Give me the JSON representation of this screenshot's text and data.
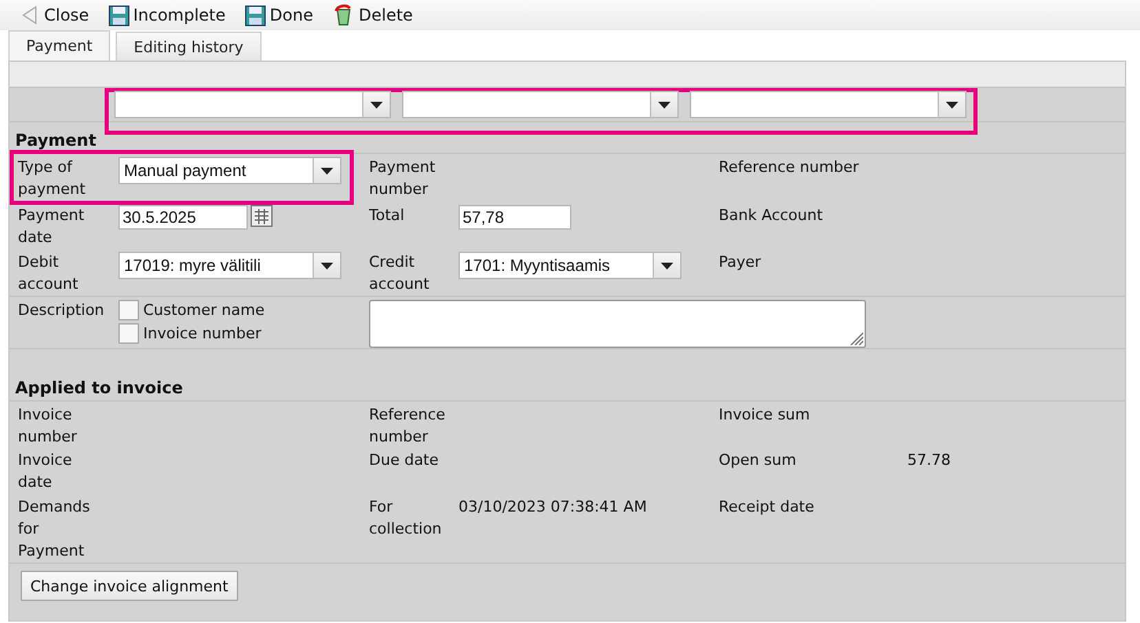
{
  "toolbar": [
    {
      "label": "Close",
      "kind": "back"
    },
    {
      "label": "Incomplete",
      "kind": "save"
    },
    {
      "label": "Done",
      "kind": "save"
    },
    {
      "label": "Delete",
      "kind": "delete"
    }
  ],
  "tabs": [
    {
      "label": "Payment",
      "selected": true
    },
    {
      "label": "Editing history",
      "selected": false
    }
  ],
  "filter_row": {
    "highlighted": true,
    "dropdowns": [
      {
        "kind": "select"
      },
      {
        "kind": "select"
      },
      {
        "kind": "select"
      }
    ]
  },
  "payment": {
    "title": "Payment",
    "type_of_payment": {
      "label": "Type of payment",
      "value": "Manual payment",
      "highlighted": true
    },
    "payment_number": {
      "label": "Payment number"
    },
    "reference_number": {
      "label": "Reference number"
    },
    "payment_date": {
      "label": "Payment date",
      "value": "30.5.2025"
    },
    "total": {
      "label": "Total",
      "value": "57,78"
    },
    "bank_account": {
      "label": "Bank Account"
    },
    "debit_account": {
      "label": "Debit account",
      "value": "17019: myre välitili"
    },
    "credit_account": {
      "label": "Credit account",
      "value": "1701: Myyntisaamis"
    },
    "payer": {
      "label": "Payer"
    },
    "description": {
      "label": "Description",
      "options": [
        {
          "label": "Customer name",
          "checked": false
        },
        {
          "label": "Invoice number",
          "checked": false
        }
      ]
    }
  },
  "applied": {
    "title": "Applied to invoice",
    "rows": [
      [
        {
          "label": "Invoice number"
        },
        {
          "label": "Reference number"
        },
        {
          "label": "Invoice sum"
        }
      ],
      [
        {
          "label": "Invoice date"
        },
        {
          "label": "Due date"
        },
        {
          "label": "Open sum",
          "value": "57.78"
        }
      ],
      [
        {
          "label": "Demands for Payment"
        },
        {
          "label": "For collection",
          "value": "03/10/2023 07:38:41 AM"
        },
        {
          "label": "Receipt date"
        }
      ]
    ],
    "button": "Change invoice alignment"
  }
}
